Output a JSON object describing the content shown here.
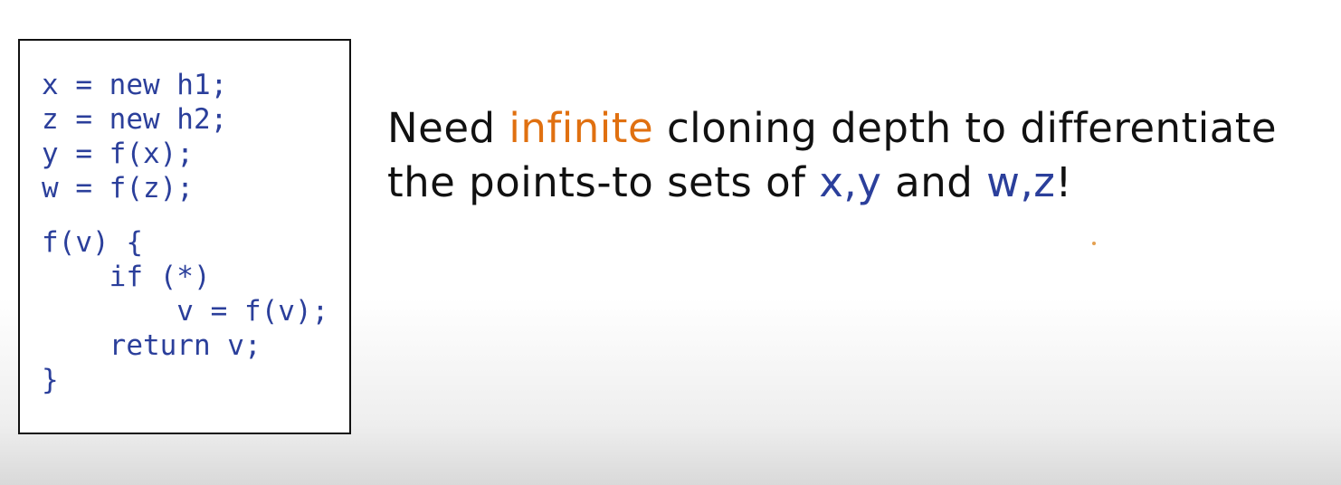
{
  "code": {
    "lines": [
      "x = new h1;",
      "z = new h2;",
      "y = f(x);",
      "w = f(z);",
      "",
      "f(v) {",
      "    if (*)",
      "        v = f(v);",
      "    return v;",
      "}"
    ]
  },
  "caption": {
    "line1": {
      "before": "Need ",
      "emphasis": "infinite",
      "after": " cloning depth to differentiate"
    },
    "line2": {
      "before": "the points-to sets of ",
      "var_pair_1": "x,y",
      "middle": " and ",
      "var_pair_2": "w,z",
      "after": "!"
    }
  },
  "colors": {
    "code_text": "#2b3f9b",
    "caption_text": "#111111",
    "emphasis_orange": "#e07010",
    "variable_blue": "#2b3f9b"
  }
}
